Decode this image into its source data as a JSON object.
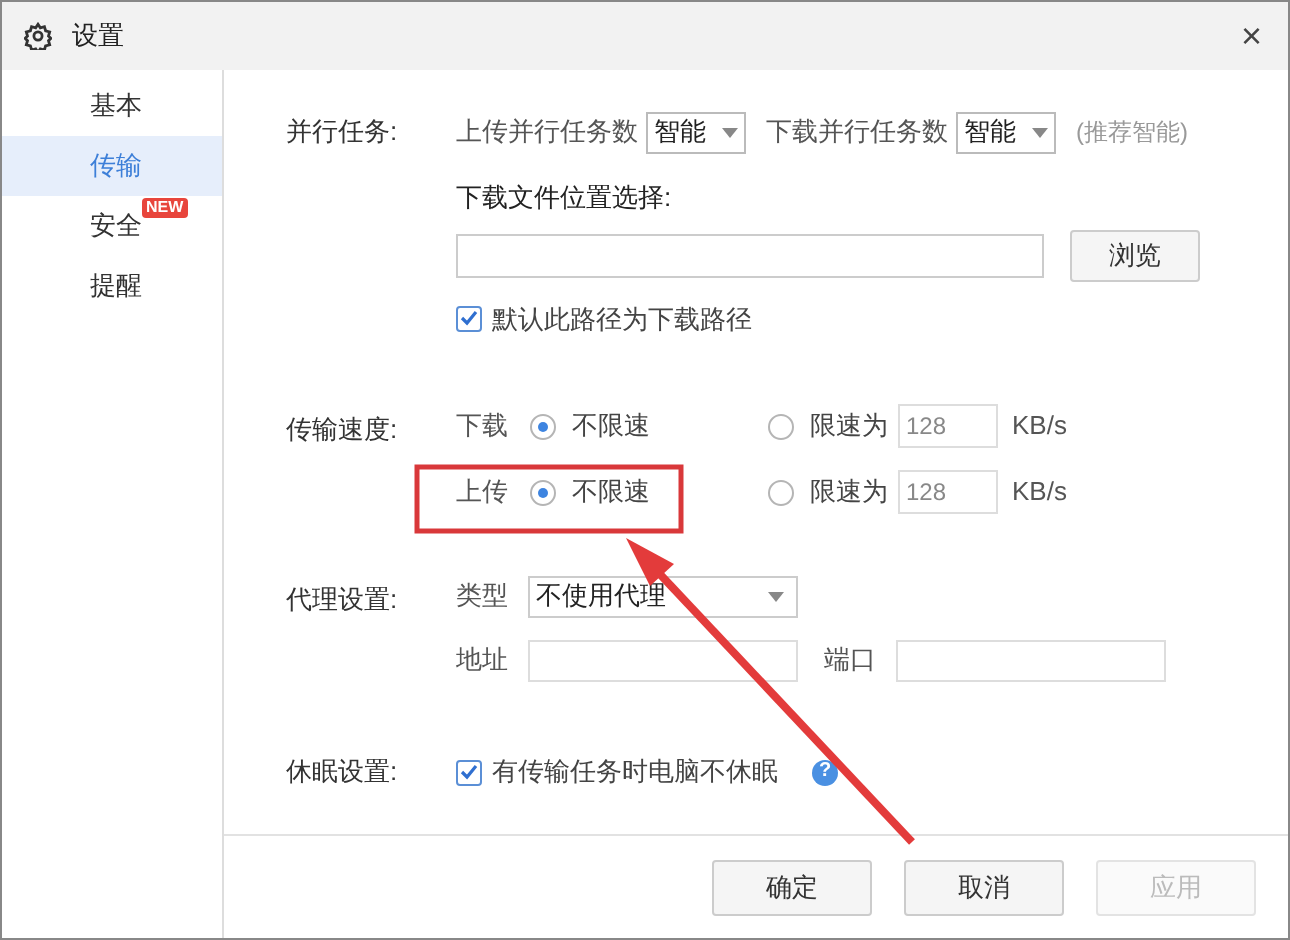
{
  "window": {
    "title": "设置",
    "close": "×"
  },
  "sidebar": {
    "items": [
      {
        "label": "基本",
        "selected": false
      },
      {
        "label": "传输",
        "selected": true
      },
      {
        "label": "安全",
        "selected": false,
        "badge": "NEW"
      },
      {
        "label": "提醒",
        "selected": false
      }
    ]
  },
  "parallel": {
    "label": "并行任务:",
    "upload_label": "上传并行任务数",
    "upload_value": "智能",
    "download_label": "下载并行任务数",
    "download_value": "智能",
    "hint": "(推荐智能)"
  },
  "download_location": {
    "label": "下载文件位置选择:",
    "browse": "浏览",
    "default_checkbox": {
      "label": "默认此路径为下载路径",
      "checked": true
    }
  },
  "speed": {
    "label": "传输速度:",
    "rows": [
      {
        "label": "下载",
        "unlimited": "不限速",
        "limited": "限速为",
        "value": "128",
        "unit": "KB/s",
        "unlimited_selected": true
      },
      {
        "label": "上传",
        "unlimited": "不限速",
        "limited": "限速为",
        "value": "128",
        "unit": "KB/s",
        "unlimited_selected": true
      }
    ]
  },
  "proxy": {
    "label": "代理设置:",
    "type_label": "类型",
    "type_value": "不使用代理",
    "address_label": "地址",
    "port_label": "端口"
  },
  "sleep": {
    "label": "休眠设置:",
    "checkbox": {
      "label": "有传输任务时电脑不休眠",
      "checked": true
    },
    "help": "?"
  },
  "buttons": [
    {
      "label": "确定",
      "disabled": false
    },
    {
      "label": "取消",
      "disabled": false
    },
    {
      "label": "应用",
      "disabled": true
    }
  ]
}
